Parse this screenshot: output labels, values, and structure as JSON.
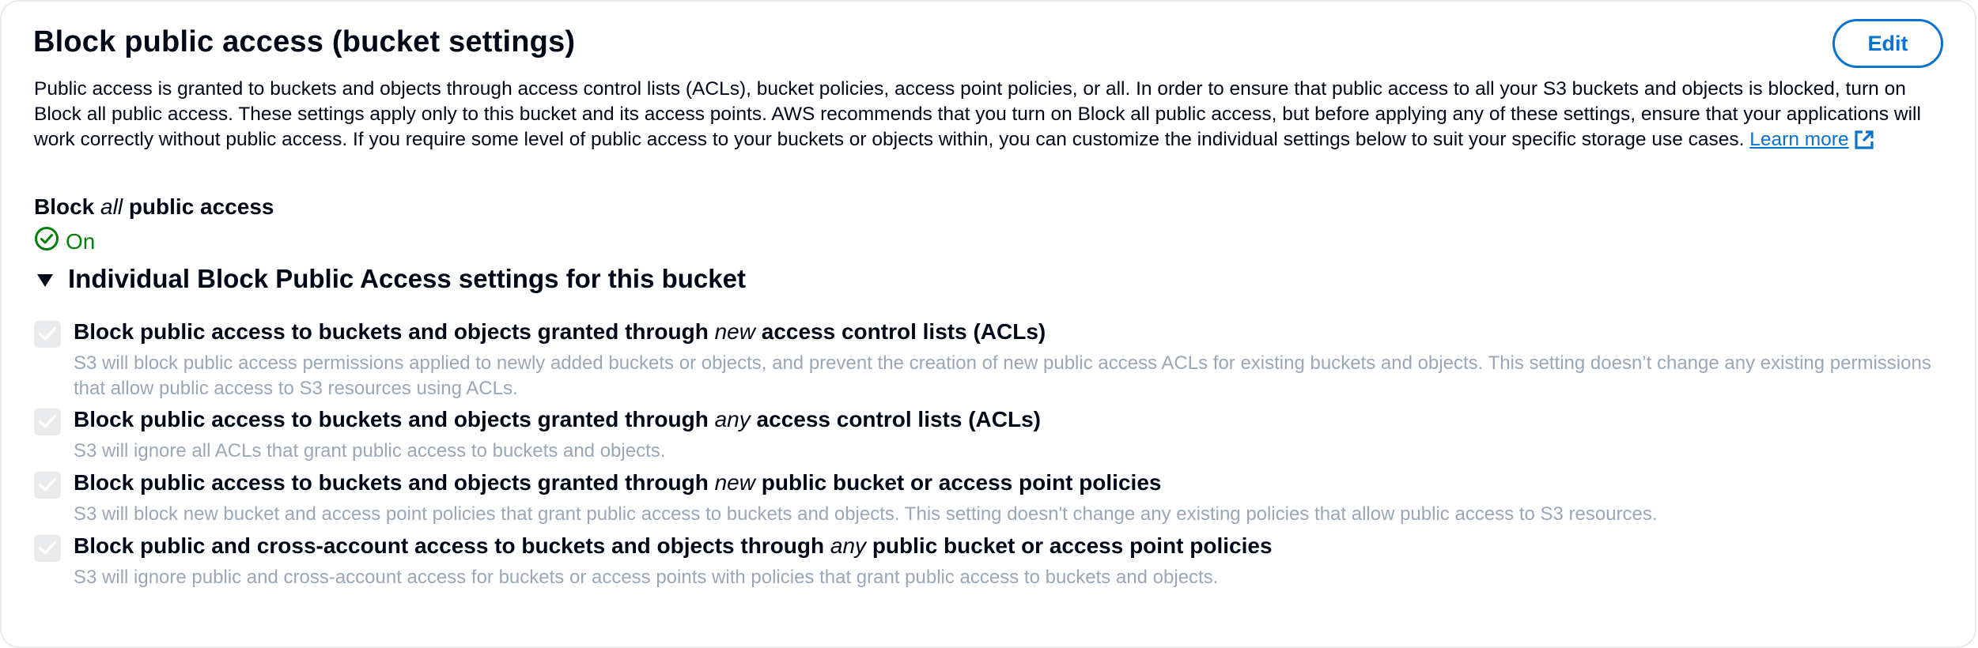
{
  "header": {
    "title": "Block public access (bucket settings)",
    "edit_label": "Edit"
  },
  "description": {
    "text": "Public access is granted to buckets and objects through access control lists (ACLs), bucket policies, access point policies, or all. In order to ensure that public access to all your S3 buckets and objects is blocked, turn on Block all public access. These settings apply only to this bucket and its access points. AWS recommends that you turn on Block all public access, but before applying any of these settings, ensure that your applications will work correctly without public access. If you require some level of public access to your buckets or objects within, you can customize the individual settings below to suit your specific storage use cases.",
    "learn_more": "Learn more",
    "learn_more_icon": "external-link-icon"
  },
  "block_all": {
    "label_pre": "Block ",
    "label_em": "all",
    "label_post": " public access",
    "status": "On",
    "status_icon": "check-circle-icon",
    "status_color": "#037f0c"
  },
  "individual": {
    "heading": "Individual Block Public Access settings for this bucket",
    "expanded": true,
    "settings": [
      {
        "title_pre": "Block public access to buckets and objects granted through ",
        "title_em": "new",
        "title_post": " access control lists (ACLs)",
        "description": "S3 will block public access permissions applied to newly added buckets or objects, and prevent the creation of new public access ACLs for existing buckets and objects. This setting doesn’t change any existing permissions that allow public access to S3 resources using ACLs.",
        "checked": true,
        "disabled": true
      },
      {
        "title_pre": "Block public access to buckets and objects granted through ",
        "title_em": "any",
        "title_post": " access control lists (ACLs)",
        "description": "S3 will ignore all ACLs that grant public access to buckets and objects.",
        "checked": true,
        "disabled": true
      },
      {
        "title_pre": "Block public access to buckets and objects granted through ",
        "title_em": "new",
        "title_post": " public bucket or access point policies",
        "description": "S3 will block new bucket and access point policies that grant public access to buckets and objects. This setting doesn't change any existing policies that allow public access to S3 resources.",
        "checked": true,
        "disabled": true
      },
      {
        "title_pre": "Block public and cross-account access to buckets and objects through ",
        "title_em": "any",
        "title_post": " public bucket or access point policies",
        "description": "S3 will ignore public and cross-account access for buckets or access points with policies that grant public access to buckets and objects.",
        "checked": true,
        "disabled": true
      }
    ]
  },
  "colors": {
    "link": "#0972d3",
    "text": "#000716",
    "muted": "#9ba7b6",
    "success": "#037f0c",
    "border": "#e9ebed"
  }
}
